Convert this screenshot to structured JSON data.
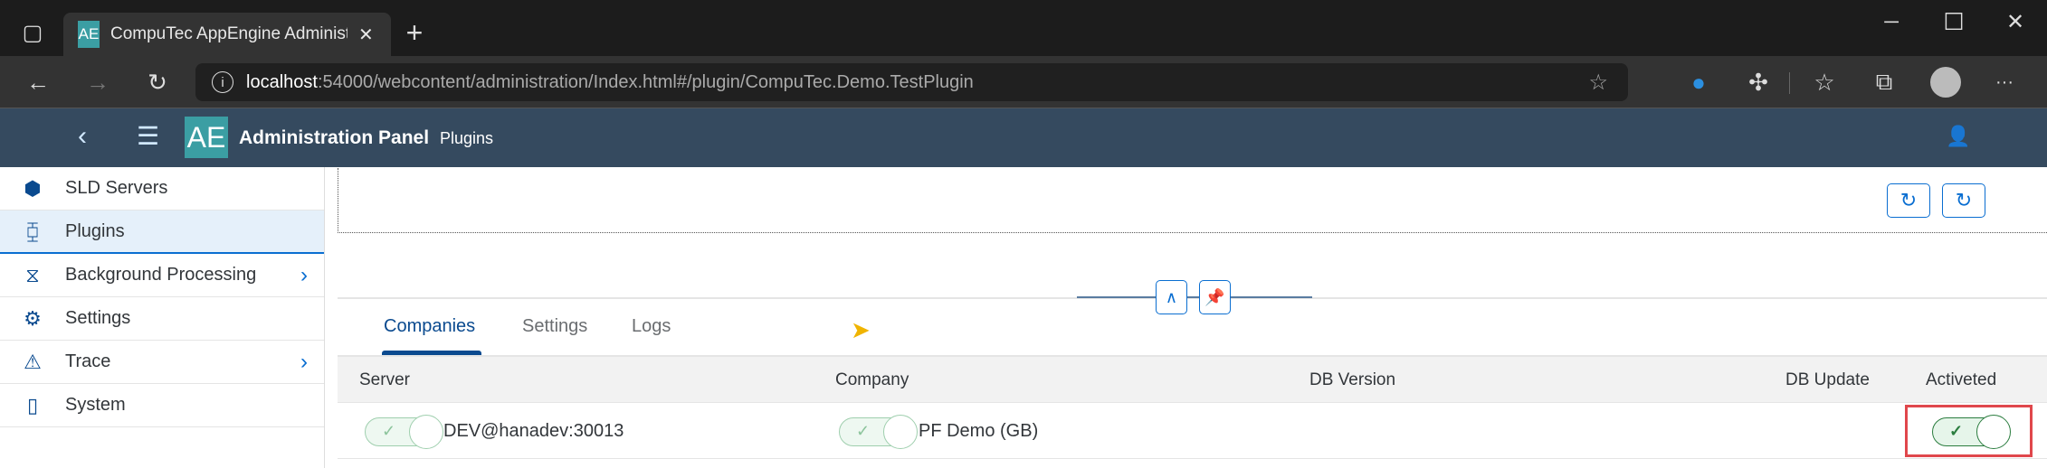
{
  "browser": {
    "tab_title": "CompuTec AppEngine Administr",
    "tab_logo": "AE",
    "url_host": "localhost",
    "url_rest": ":54000/webcontent/administration/Index.html#/plugin/CompuTec.Demo.TestPlugin"
  },
  "header": {
    "logo": "AE",
    "title": "Administration Panel",
    "subtitle": "Plugins"
  },
  "sidebar": {
    "items": [
      {
        "label": "SLD Servers",
        "icon": "sld-servers-icon",
        "selected": false,
        "has_children": false
      },
      {
        "label": "Plugins",
        "icon": "plugins-icon",
        "selected": true,
        "has_children": false
      },
      {
        "label": "Background Processing",
        "icon": "background-processing-icon",
        "selected": false,
        "has_children": true
      },
      {
        "label": "Settings",
        "icon": "settings-icon",
        "selected": false,
        "has_children": false
      },
      {
        "label": "Trace",
        "icon": "warning-icon",
        "selected": false,
        "has_children": true
      },
      {
        "label": "System",
        "icon": "device-icon",
        "selected": false,
        "has_children": false
      }
    ]
  },
  "tabs": [
    {
      "label": "Companies",
      "active": true
    },
    {
      "label": "Settings",
      "active": false
    },
    {
      "label": "Logs",
      "active": false
    }
  ],
  "table": {
    "columns": [
      "Server",
      "Company",
      "DB Version",
      "DB Update",
      "Activeted"
    ],
    "rows": [
      {
        "server": "DEV@hanadev:30013",
        "server_on": true,
        "company": "PF Demo (GB)",
        "company_on": true,
        "db_version": "",
        "db_update": "",
        "activated": true
      }
    ]
  },
  "colors": {
    "header": "#354a5f",
    "accent": "#0a6ed1",
    "highlight": "#e0474c",
    "toggle_on": "#2b7d3f"
  }
}
